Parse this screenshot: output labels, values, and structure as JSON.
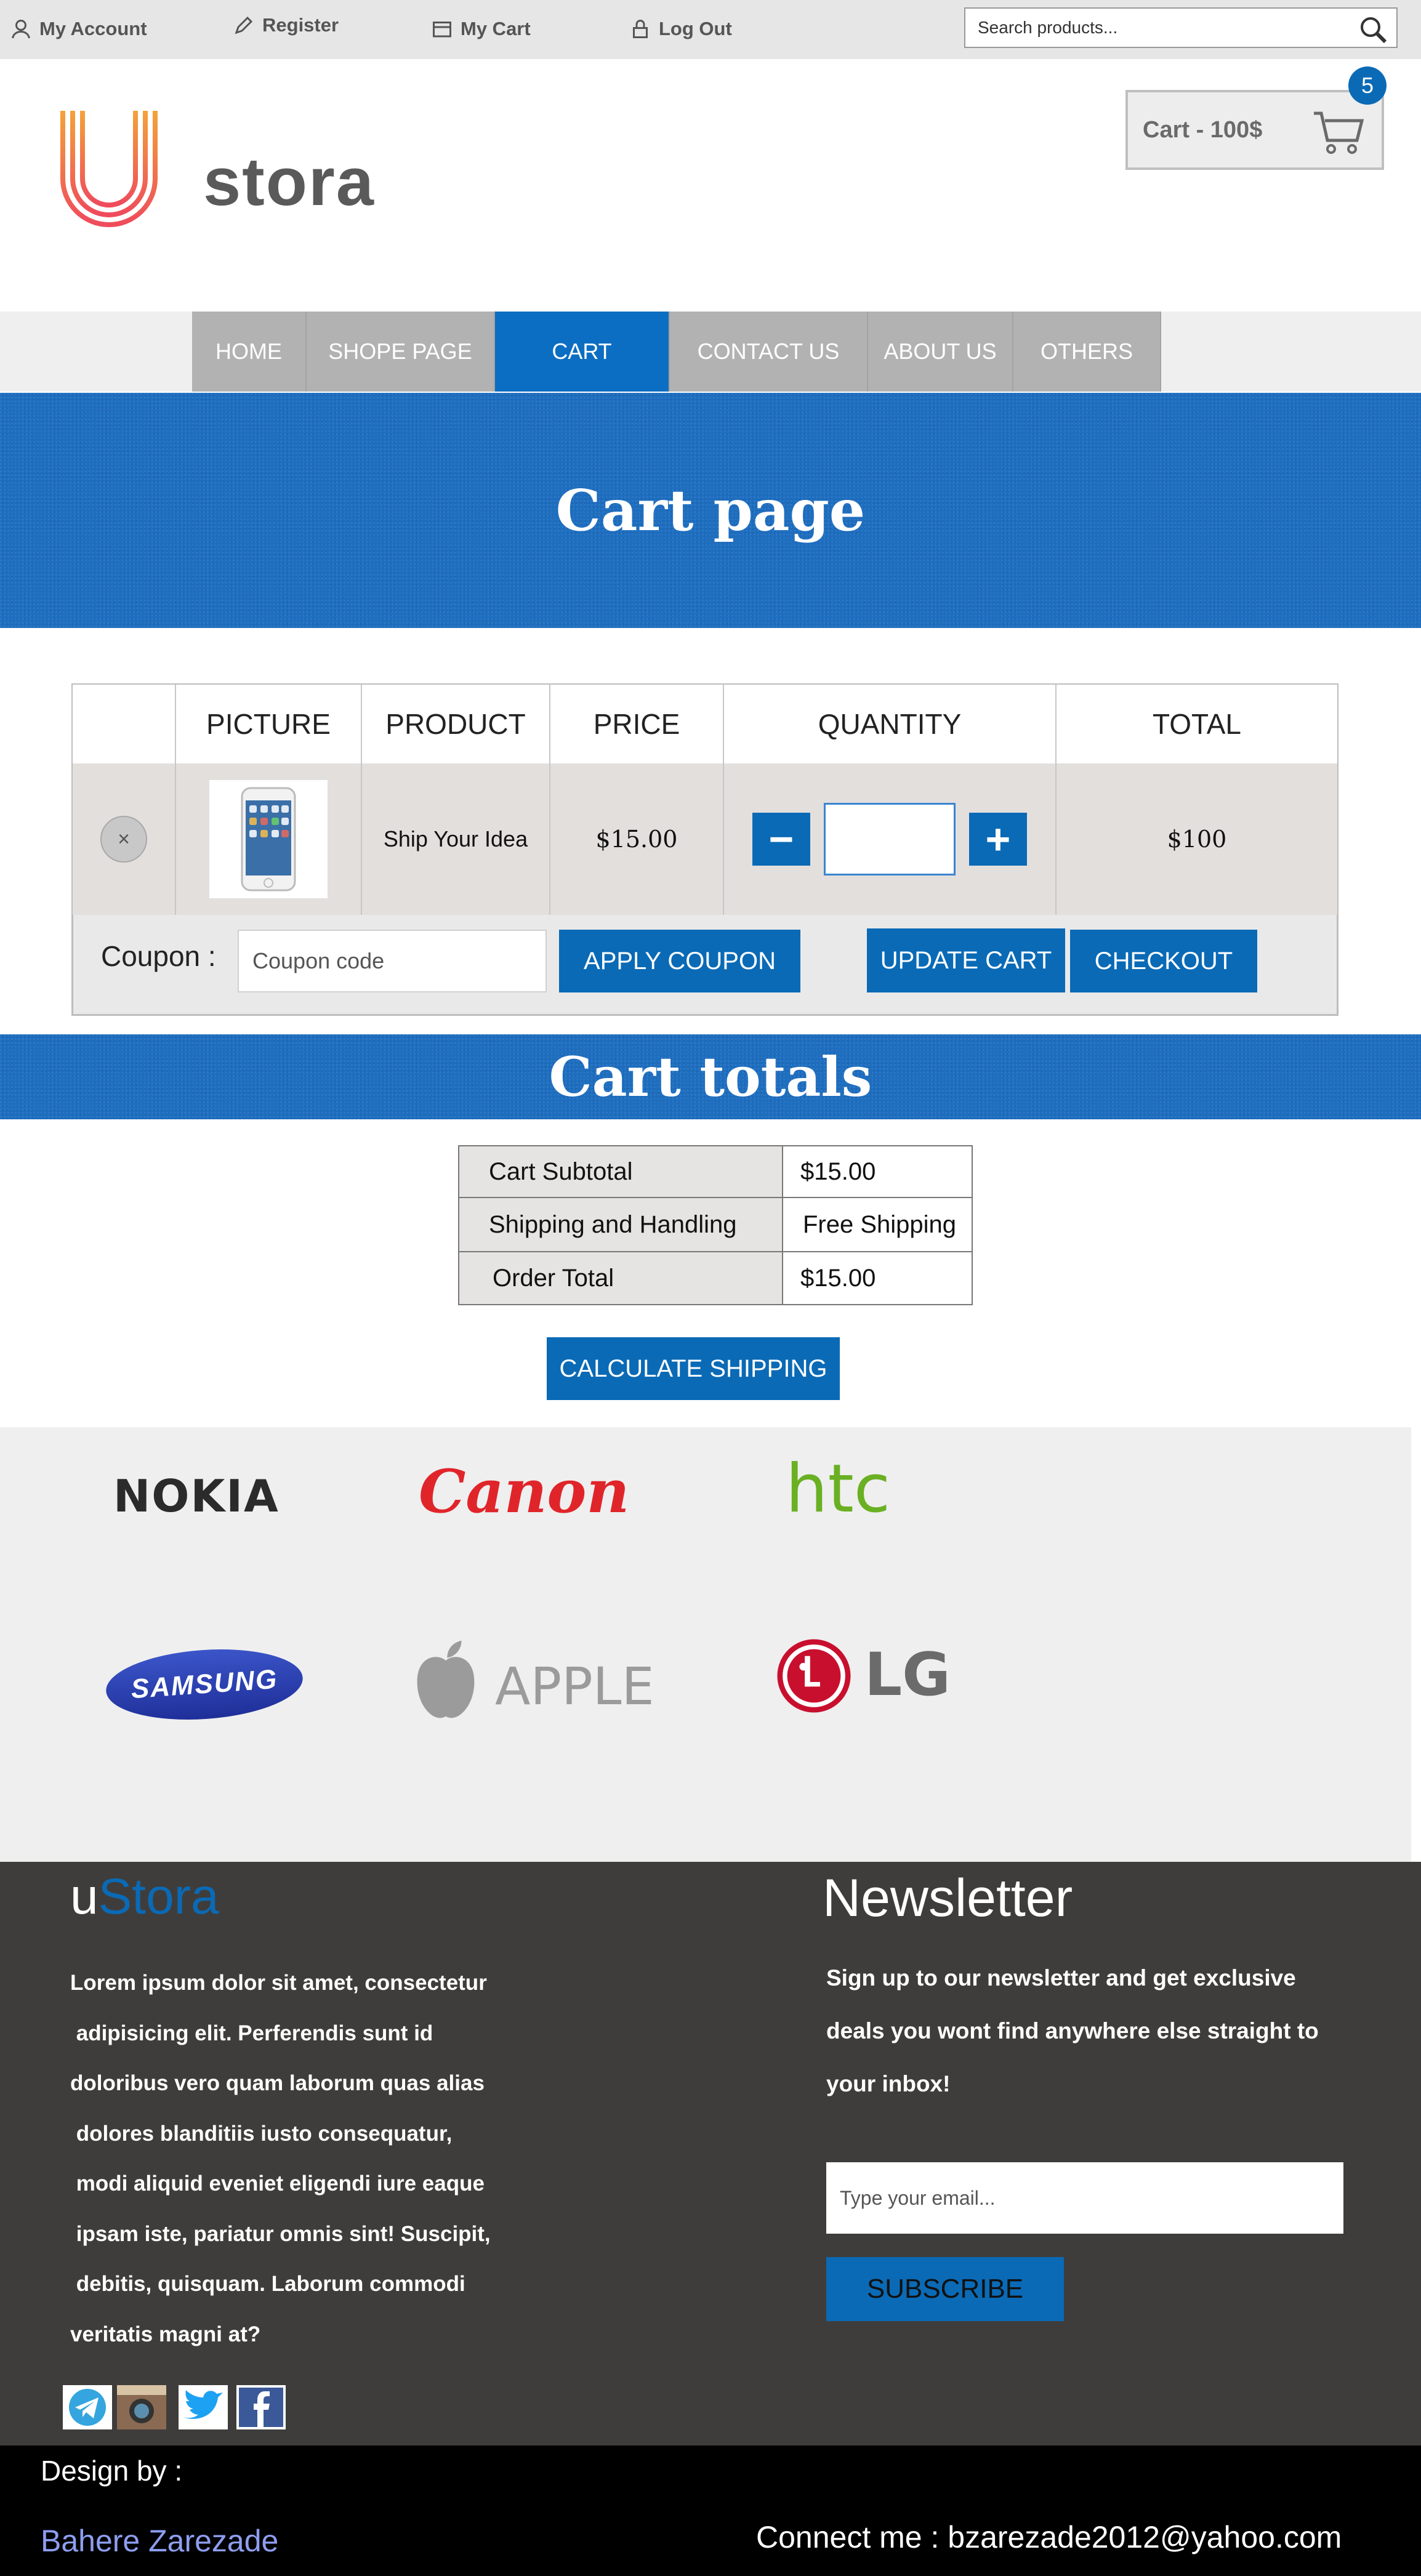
{
  "topbar": {
    "my_account": "My Account",
    "register": "Register",
    "my_cart": "My Cart",
    "log_out": "Log Out",
    "search_placeholder": "Search products..."
  },
  "header": {
    "cart_label": "Cart  - 100$",
    "cart_count": "5",
    "logo_text": "stora",
    "logo_letter": "U"
  },
  "nav": {
    "items": [
      {
        "label": "HOME"
      },
      {
        "label": "SHOPE PAGE"
      },
      {
        "label": "CART",
        "active": true
      },
      {
        "label": "CONTACT US"
      },
      {
        "label": "ABOUT US"
      },
      {
        "label": "OTHERS"
      }
    ]
  },
  "hero": {
    "title": "Cart page"
  },
  "cart_table": {
    "headers": [
      "PICTURE",
      "PRODUCT",
      "PRICE",
      "QUANTITY",
      "TOTAL"
    ],
    "row": {
      "remove": "×",
      "product": "Ship Your Idea",
      "price": "$15.00",
      "quantity_value": "",
      "total": "$100",
      "minus": "−",
      "plus": "+"
    }
  },
  "coupon": {
    "label": "Coupon :",
    "placeholder": "Coupon code",
    "apply": "APPLY COUPON",
    "update": "UPDATE CART",
    "checkout": "CHECKOUT"
  },
  "totals": {
    "title": "Cart totals",
    "rows": [
      {
        "label": "Cart Subtotal",
        "value": "$15.00"
      },
      {
        "label": "Shipping and Handling",
        "value": "Free Shipping"
      },
      {
        "label": "Order Total",
        "value": "$15.00"
      }
    ],
    "calculate": "CALCULATE SHIPPING"
  },
  "brands": [
    "NOKIA",
    "Canon",
    "htc",
    "SAMSUNG",
    "APPLE",
    "LG"
  ],
  "colors": {
    "primary": "#0a6ab6",
    "footer_bg": "#3f3d3b",
    "nokia": "#2b2b2b",
    "canon": "#e0252a",
    "htc": "#6ab023",
    "samsung": "#1f2f99",
    "apple": "#9b9b9b",
    "lg": "#c8102e"
  },
  "footer": {
    "brand_u": "u",
    "brand_stora": "Stora",
    "about_lines": [
      "Lorem ipsum dolor sit amet, consectetur",
      " adipisicing elit. Perferendis sunt id",
      "doloribus vero quam laborum quas alias",
      " dolores blanditiis iusto consequatur,",
      " modi aliquid eveniet eligendi iure eaque",
      " ipsam iste, pariatur omnis sint! Suscipit,",
      " debitis, quisquam. Laborum commodi",
      "veritatis magni at?"
    ],
    "newsletter_title": "Newsletter",
    "newsletter_lines": [
      "Sign up to our newsletter and get exclusive",
      "deals you wont find anywhere else straight to",
      "your inbox!"
    ],
    "email_placeholder": "Type your email...",
    "subscribe": "SUBSCRIBE",
    "social_icons": [
      "telegram-icon",
      "instagram-icon",
      "twitter-icon",
      "facebook-icon"
    ]
  },
  "bottom": {
    "design_by": "Design by :",
    "designer": "Bahere Zarezade",
    "connect": "Connect me : bzarezade2012@yahoo.com"
  }
}
